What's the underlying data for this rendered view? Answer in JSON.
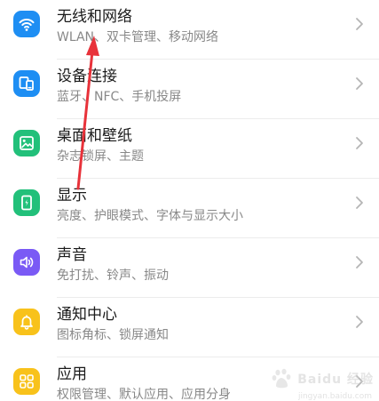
{
  "settings_list": {
    "items": [
      {
        "title": "无线和网络",
        "subtitle": "WLAN、双卡管理、移动网络",
        "icon": "wifi-icon",
        "icon_color": "#1e8ef3"
      },
      {
        "title": "设备连接",
        "subtitle": "蓝牙、NFC、手机投屏",
        "icon": "device-connection-icon",
        "icon_color": "#1e8ef3"
      },
      {
        "title": "桌面和壁纸",
        "subtitle": "杂志锁屏、主题",
        "icon": "wallpaper-icon",
        "icon_color": "#22c07a"
      },
      {
        "title": "显示",
        "subtitle": "亮度、护眼模式、字体与显示大小",
        "icon": "display-icon",
        "icon_color": "#22c07a"
      },
      {
        "title": "声音",
        "subtitle": "免打扰、铃声、振动",
        "icon": "sound-icon",
        "icon_color": "#7a5af5"
      },
      {
        "title": "通知中心",
        "subtitle": "图标角标、锁屏通知",
        "icon": "bell-icon",
        "icon_color": "#f8c21b"
      },
      {
        "title": "应用",
        "subtitle": "权限管理、默认应用、应用分身",
        "icon": "apps-grid-icon",
        "icon_color": "#f8c21b"
      }
    ]
  },
  "annotation": {
    "arrow_color": "#e8323a"
  },
  "watermark": {
    "text": "Baidu 经验",
    "sub": "jingyan.baidu.com"
  }
}
